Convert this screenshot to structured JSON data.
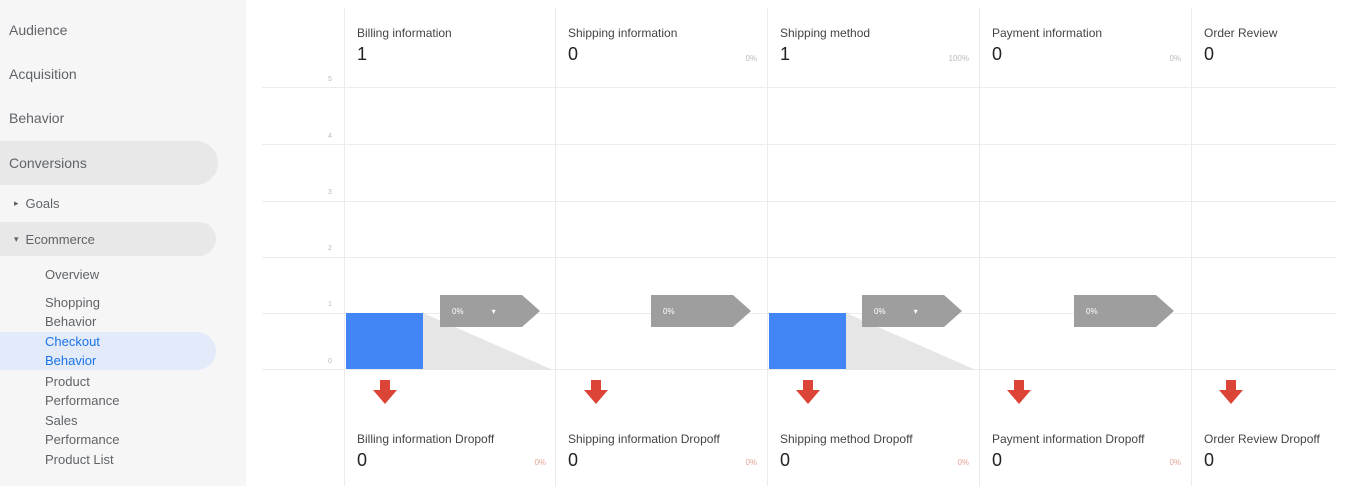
{
  "sidebar": {
    "nav": [
      {
        "label": "Audience"
      },
      {
        "label": "Acquisition"
      },
      {
        "label": "Behavior"
      },
      {
        "label": "Conversions"
      }
    ],
    "sub": [
      {
        "label": "Goals",
        "caret": "▸"
      },
      {
        "label": "Ecommerce",
        "caret": "▾"
      }
    ],
    "leaves": [
      {
        "label": "Overview"
      },
      {
        "label": "Shopping Behavior"
      },
      {
        "label": "Checkout Behavior"
      },
      {
        "label": "Product Performance"
      },
      {
        "label": "Sales Performance"
      },
      {
        "label": "Product List"
      }
    ]
  },
  "funnel": {
    "y_ticks": [
      "5",
      "4",
      "3",
      "2",
      "1",
      "0"
    ],
    "steps": [
      {
        "title": "Billing information",
        "value": "1",
        "pct": "",
        "bar_value": 1,
        "flag_label": "0%",
        "flag_dropdown": "▾",
        "dropoff_title": "Billing information Dropoff",
        "dropoff_value": "0",
        "dropoff_pct": "0%"
      },
      {
        "title": "Shipping information",
        "value": "0",
        "pct": "0%",
        "bar_value": 0,
        "flag_label": "0%",
        "flag_dropdown": "",
        "dropoff_title": "Shipping information Dropoff",
        "dropoff_value": "0",
        "dropoff_pct": "0%"
      },
      {
        "title": "Shipping method",
        "value": "1",
        "pct": "100%",
        "bar_value": 1,
        "flag_label": "0%",
        "flag_dropdown": "▾",
        "dropoff_title": "Shipping method Dropoff",
        "dropoff_value": "0",
        "dropoff_pct": "0%"
      },
      {
        "title": "Payment information",
        "value": "0",
        "pct": "0%",
        "bar_value": 0,
        "flag_label": "0%",
        "flag_dropdown": "",
        "dropoff_title": "Payment information Dropoff",
        "dropoff_value": "0",
        "dropoff_pct": "0%"
      },
      {
        "title": "Order Review",
        "value": "0",
        "pct": "",
        "bar_value": 0,
        "flag_label": "",
        "flag_dropdown": "",
        "dropoff_title": "Order Review Dropoff",
        "dropoff_value": "0",
        "dropoff_pct": ""
      }
    ]
  },
  "colors": {
    "bar": "#4285f4",
    "flag": "#9e9e9e",
    "down_arrow": "#db4437",
    "active_link": "#1a73e8"
  }
}
